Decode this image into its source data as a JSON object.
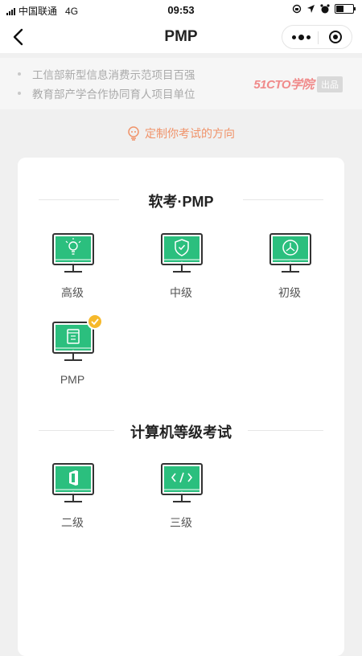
{
  "status_bar": {
    "carrier": "中国联通",
    "network": "4G",
    "time": "09:53"
  },
  "nav": {
    "title": "PMP"
  },
  "banner": {
    "items": [
      "工信部新型信息消费示范项目百强",
      "教育部产学合作协同育人项目单位"
    ],
    "brand_name": "51CTO学院",
    "brand_badge": "出品"
  },
  "direction_text": "定制你考试的方向",
  "sections": [
    {
      "title": "软考·PMP",
      "items": [
        {
          "label": "高级",
          "icon": "lightbulb-icon",
          "selected": false
        },
        {
          "label": "中级",
          "icon": "shield-icon",
          "selected": false
        },
        {
          "label": "初级",
          "icon": "compass-icon",
          "selected": false
        },
        {
          "label": "PMP",
          "icon": "book-icon",
          "selected": true
        }
      ]
    },
    {
      "title": "计算机等级考试",
      "items": [
        {
          "label": "二级",
          "icon": "office-icon",
          "selected": false
        },
        {
          "label": "三级",
          "icon": "code-icon",
          "selected": false
        }
      ]
    }
  ],
  "colors": {
    "accent_green": "#2bbf7e",
    "check_yellow": "#f6b92b",
    "direction_orange": "#f0936a"
  }
}
